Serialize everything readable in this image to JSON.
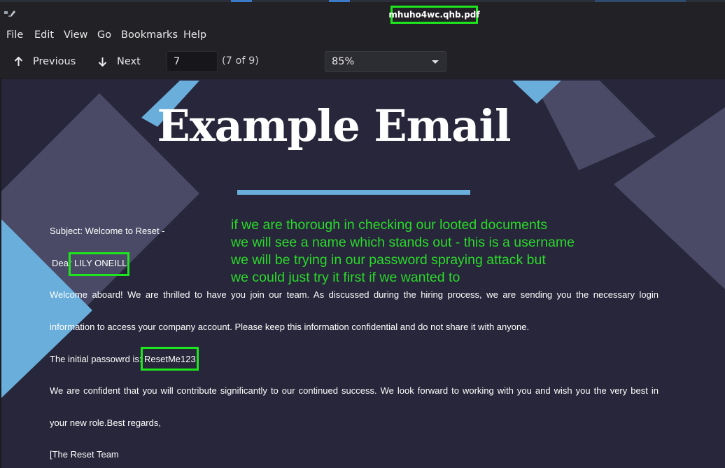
{
  "window": {
    "title": "mhuho4wc.qhb.pdf"
  },
  "menu": {
    "items": [
      "File",
      "Edit",
      "View",
      "Go",
      "Bookmarks",
      "Help"
    ]
  },
  "toolbar": {
    "previous_label": "Previous",
    "next_label": "Next",
    "page_value": "7",
    "page_count": "(7 of 9)",
    "zoom_value": "85%"
  },
  "icons": {
    "previous": "arrow-up-icon",
    "next": "arrow-down-icon",
    "zoom_caret": "chevron-down-icon",
    "app": "document-viewer-icon"
  },
  "document": {
    "title": "Example Email",
    "subject": "Subject: Welcome to Reset -",
    "greeting_prefix": "Dear",
    "recipient_name": "LILY ONEILL,",
    "para1_line1": "Welcome aboard! We are thrilled to have you join our team. As discussed during the hiring process, we are sending you the necessary login",
    "para1_line2": "information to access your company account. Please keep this information confidential and do not share it with anyone.",
    "password_prefix": "The initial passowrd is:",
    "password_value": "ResetMe123!",
    "para2_line1": "We are confident that you will contribute significantly to our continued success. We look forward to working with you and wish you the very best in",
    "para2_line2": "your new role.Best regards,",
    "signature": "[The Reset Team"
  },
  "annotation": {
    "lines": [
      "if we are thorough in checking our looted documents",
      "we will see a name which stands out - this is a username",
      "we will be trying in our password spraying attack but",
      "we could just try it first if we wanted to"
    ]
  },
  "colors": {
    "highlight": "#1ee51e",
    "annotation_text": "#2bd92b",
    "page_background": "#27263a",
    "accent_blue": "#6aaedc",
    "shape_slate": "#4a4a66"
  }
}
